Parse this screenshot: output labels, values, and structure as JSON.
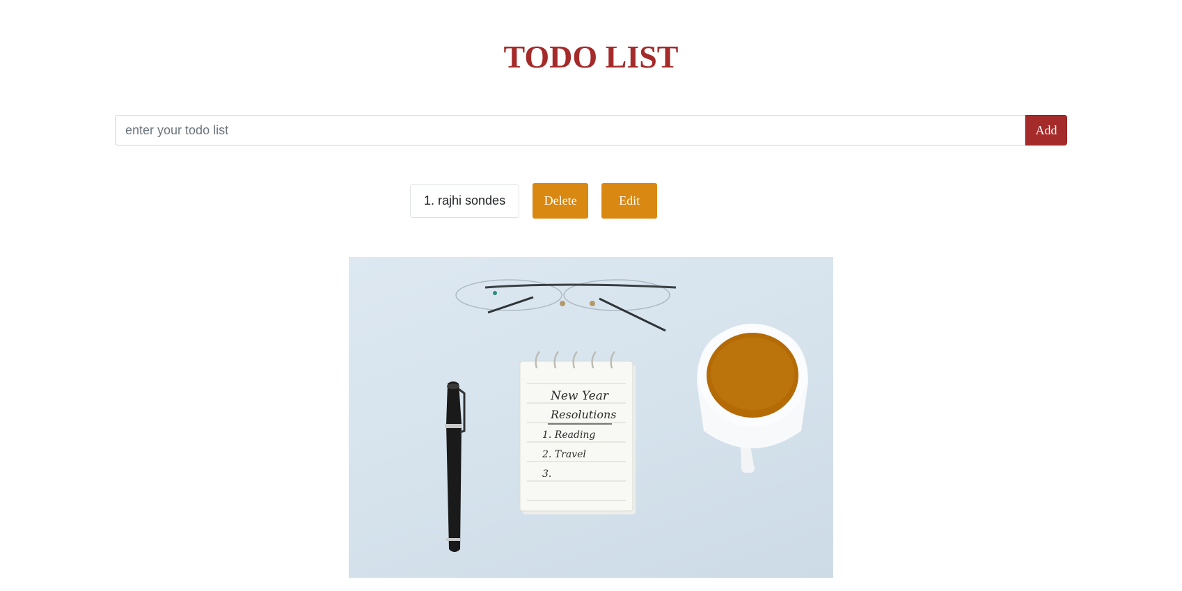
{
  "header": {
    "title": "TODO LIST"
  },
  "form": {
    "placeholder": "enter your todo list",
    "value": "",
    "add_label": "Add"
  },
  "todos": [
    {
      "text": "1. rajhi sondes",
      "delete_label": "Delete",
      "edit_label": "Edit"
    }
  ],
  "photo": {
    "notepad_lines": [
      "New Year",
      "Resolutions",
      "1. Reading",
      "2. Travel",
      "3."
    ]
  },
  "colors": {
    "title": "#a52a2a",
    "add_button": "#a52a2a",
    "action_buttons": "#d98812",
    "photo_background": "#d5e2ec"
  }
}
